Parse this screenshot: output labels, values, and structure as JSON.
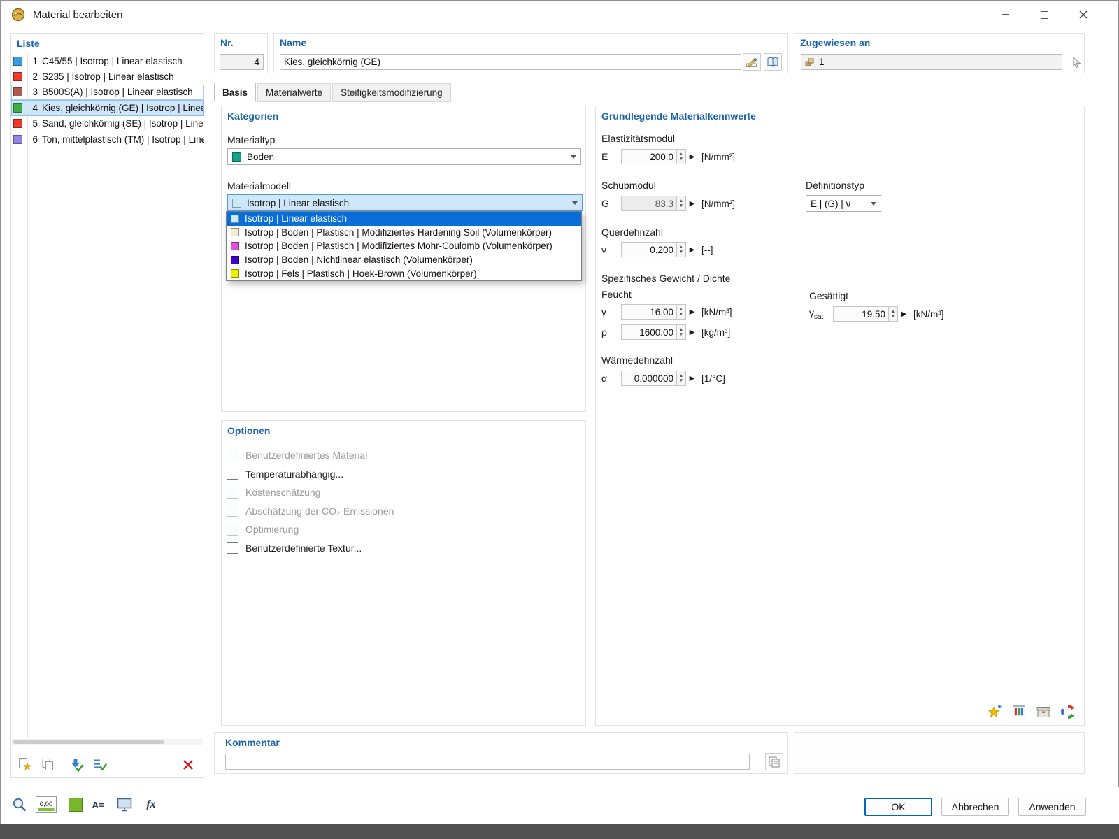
{
  "window": {
    "title": "Material bearbeiten"
  },
  "list": {
    "header": "Liste",
    "items": [
      {
        "num": "1",
        "label": "C45/55 | Isotrop | Linear elastisch",
        "color": "#3d9be0",
        "state": ""
      },
      {
        "num": "2",
        "label": "S235 | Isotrop | Linear elastisch",
        "color": "#ee3a2a",
        "state": ""
      },
      {
        "num": "3",
        "label": "B500S(A) | Isotrop | Linear elastisch",
        "color": "#b25a50",
        "state": "focused"
      },
      {
        "num": "4",
        "label": "Kies, gleichkörnig (GE) | Isotrop | Linear elastisch",
        "color": "#3fae49",
        "state": "selected"
      },
      {
        "num": "5",
        "label": "Sand, gleichkörnig (SE) | Isotrop | Linear elastisch",
        "color": "#ee3a2a",
        "state": ""
      },
      {
        "num": "6",
        "label": "Ton, mittelplastisch (TM) | Isotrop | Linear elastisch",
        "color": "#8f86ea",
        "state": ""
      }
    ]
  },
  "header": {
    "nr_label": "Nr.",
    "nr_value": "4",
    "name_label": "Name",
    "name_value": "Kies, gleichkörnig (GE)",
    "assigned_label": "Zugewiesen an",
    "assigned_value": "1"
  },
  "tabs": [
    {
      "label": "Basis",
      "active": true
    },
    {
      "label": "Materialwerte",
      "active": false
    },
    {
      "label": "Steifigkeitsmodifizierung",
      "active": false
    }
  ],
  "categories": {
    "header": "Kategorien",
    "materialtyp": {
      "label": "Materialtyp",
      "value": "Boden",
      "color": "#13a38d"
    },
    "materialmodell": {
      "label": "Materialmodell",
      "value": "Isotrop | Linear elastisch",
      "color": "#c8ecf7"
    },
    "dropdown_items": [
      {
        "label": "Isotrop | Linear elastisch",
        "color": "#c8ecf7",
        "selected": true
      },
      {
        "label": "Isotrop | Boden | Plastisch | Modifiziertes Hardening Soil (Volumenkörper)",
        "color": "#f6ecca",
        "selected": false
      },
      {
        "label": "Isotrop | Boden | Plastisch | Modifiziertes Mohr-Coulomb (Volumenkörper)",
        "color": "#dd52dd",
        "selected": false
      },
      {
        "label": "Isotrop | Boden | Nichtlinear elastisch (Volumenkörper)",
        "color": "#3a06c9",
        "selected": false
      },
      {
        "label": "Isotrop | Fels | Plastisch | Hoek-Brown (Volumenkörper)",
        "color": "#eef000",
        "selected": false
      }
    ]
  },
  "props": {
    "header": "Grundlegende Materialkennwerte",
    "elastizitaet_label": "Elastizitätsmodul",
    "e_symbol": "E",
    "e_value": "200.0",
    "e_unit": "[N/mm²]",
    "schubmodul_label": "Schubmodul",
    "g_symbol": "G",
    "g_value": "83.3",
    "g_unit": "[N/mm²]",
    "definitionstyp_label": "Definitionstyp",
    "definitionstyp_value": "E | (G) | ν",
    "querdehnzahl_label": "Querdehnzahl",
    "nu_symbol": "ν",
    "nu_value": "0.200",
    "nu_unit": "[--]",
    "gewicht_label": "Spezifisches Gewicht / Dichte",
    "feucht_label": "Feucht",
    "gesaettigt_label": "Gesättigt",
    "gamma_symbol": "γ",
    "gamma_value": "16.00",
    "gamma_unit": "[kN/m³]",
    "gammasat_symbol": "γ",
    "gammasat_sub": "sat",
    "gammasat_value": "19.50",
    "gammasat_unit": "[kN/m³]",
    "rho_symbol": "ρ",
    "rho_value": "1600.00",
    "rho_unit": "[kg/m³]",
    "waerme_label": "Wärmedehnzahl",
    "alpha_symbol": "α",
    "alpha_value": "0.000000",
    "alpha_unit": "[1/°C]"
  },
  "options": {
    "header": "Optionen",
    "items": [
      {
        "label": "Benutzerdefiniertes Material",
        "checked": true,
        "disabled": true
      },
      {
        "label": "Temperaturabhängig...",
        "checked": false,
        "disabled": false
      },
      {
        "label": "Kostenschätzung",
        "checked": false,
        "disabled": true
      },
      {
        "label": "Abschätzung der CO₂-Emissionen",
        "checked": false,
        "disabled": true
      },
      {
        "label": "Optimierung",
        "checked": false,
        "disabled": true
      },
      {
        "label": "Benutzerdefinierte Textur...",
        "checked": false,
        "disabled": false
      }
    ]
  },
  "comment": {
    "header": "Kommentar",
    "value": ""
  },
  "statusbar": {
    "decimal_display": "0,00",
    "font_icon_label": "A=",
    "fx_icon_label": "fx"
  },
  "footer": {
    "ok_label": "OK",
    "cancel_label": "Abbrechen",
    "apply_label": "Anwenden"
  }
}
